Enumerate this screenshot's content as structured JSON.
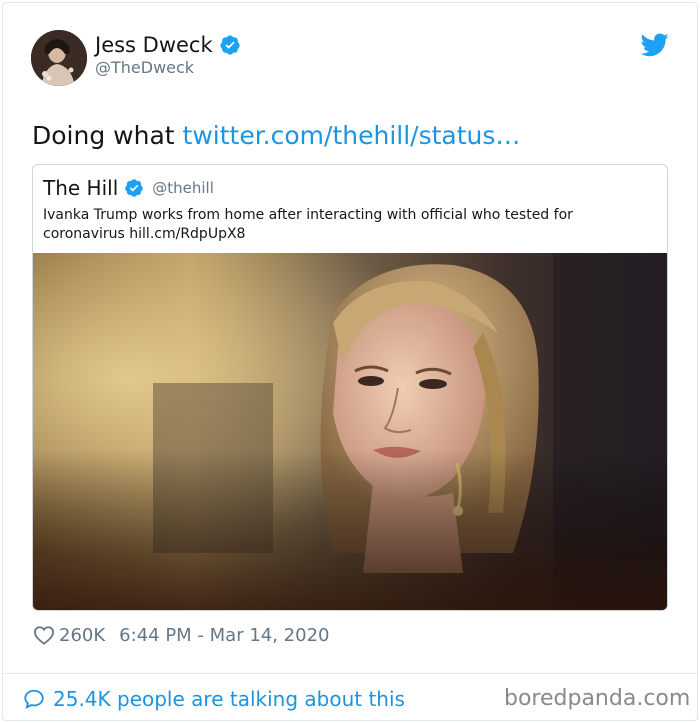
{
  "author": {
    "name": "Jess Dweck",
    "handle": "@TheDweck",
    "verified_icon": "verified-badge-icon",
    "avatar": "avatar"
  },
  "tweet": {
    "text": "Doing what ",
    "link": "twitter.com/thehill/status…"
  },
  "quoted_tweet": {
    "name": "The Hill",
    "handle": "@thehill",
    "text": "Ivanka Trump works from home after interacting with official who tested for coronavirus hill.cm/RdpUpX8"
  },
  "meta": {
    "likes": "260K",
    "timestamp": "6:44 PM - Mar 14, 2020"
  },
  "footer": {
    "talking": "25.4K people are talking about this"
  },
  "watermark": "boredpanda.com",
  "colors": {
    "link": "#1b95e0",
    "verified": "#1da1f2",
    "muted": "#657786"
  }
}
